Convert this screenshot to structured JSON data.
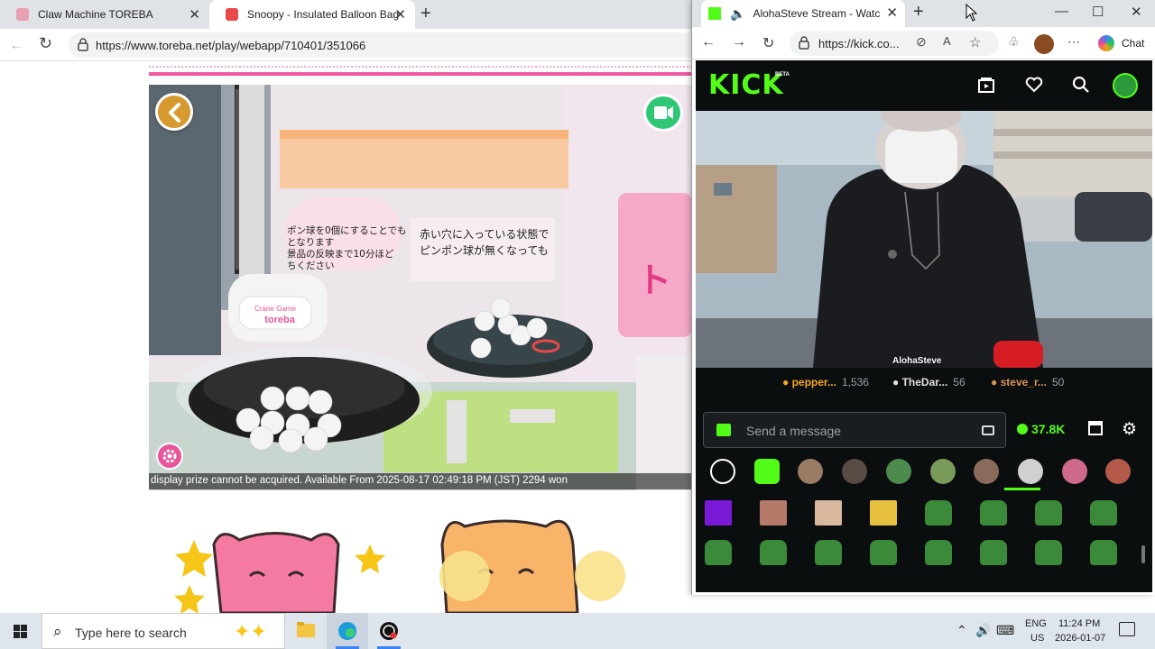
{
  "browser1": {
    "tabs": [
      {
        "title": "Claw Machine TOREBA",
        "favicon_color": "#e8a0b0"
      },
      {
        "title": "Snoopy - Insulated Balloon Bag S",
        "favicon_color": "#e84a4a"
      }
    ],
    "url": "https://www.toreba.net/play/webapp/710401/351066",
    "game": {
      "caption": "display prize cannot be acquired. Available From 2025-08-17 02:49:18 PM (JST) 2294 won",
      "sign_text_line1": "赤い穴に入っている状態で",
      "sign_text_line2": "ピンポン球が無くなっても",
      "sign_left_line1": "ポン球を0個にすることでも",
      "sign_left_line2": "となります",
      "sign_left_line3": "景品の反映まで10分ほど",
      "sign_left_line4": "ちください",
      "crane_label_top": "Crane Game",
      "crane_label_main": "toreba"
    }
  },
  "browser2": {
    "tab_title": "AlohaSteve Stream - Watch L",
    "url": "https://kick.co...",
    "chat_label": "Chat",
    "kick": {
      "logo": "KICK",
      "beta": "BETA",
      "streamer": "AlohaSteve",
      "leaderboard": [
        {
          "name": "pepper...",
          "count": "1,536",
          "color": "#f5a623"
        },
        {
          "name": "TheDar...",
          "count": "56",
          "color": "#e0e0e0"
        },
        {
          "name": "steve_r...",
          "count": "50",
          "color": "#d9955a"
        }
      ],
      "chat_placeholder": "Send a message",
      "kicks_count": "37.8K"
    }
  },
  "taskbar": {
    "search_placeholder": "Type here to search",
    "lang_line1": "ENG",
    "lang_line2": "US",
    "time": "11:24 PM",
    "date": "2026-01-07"
  }
}
